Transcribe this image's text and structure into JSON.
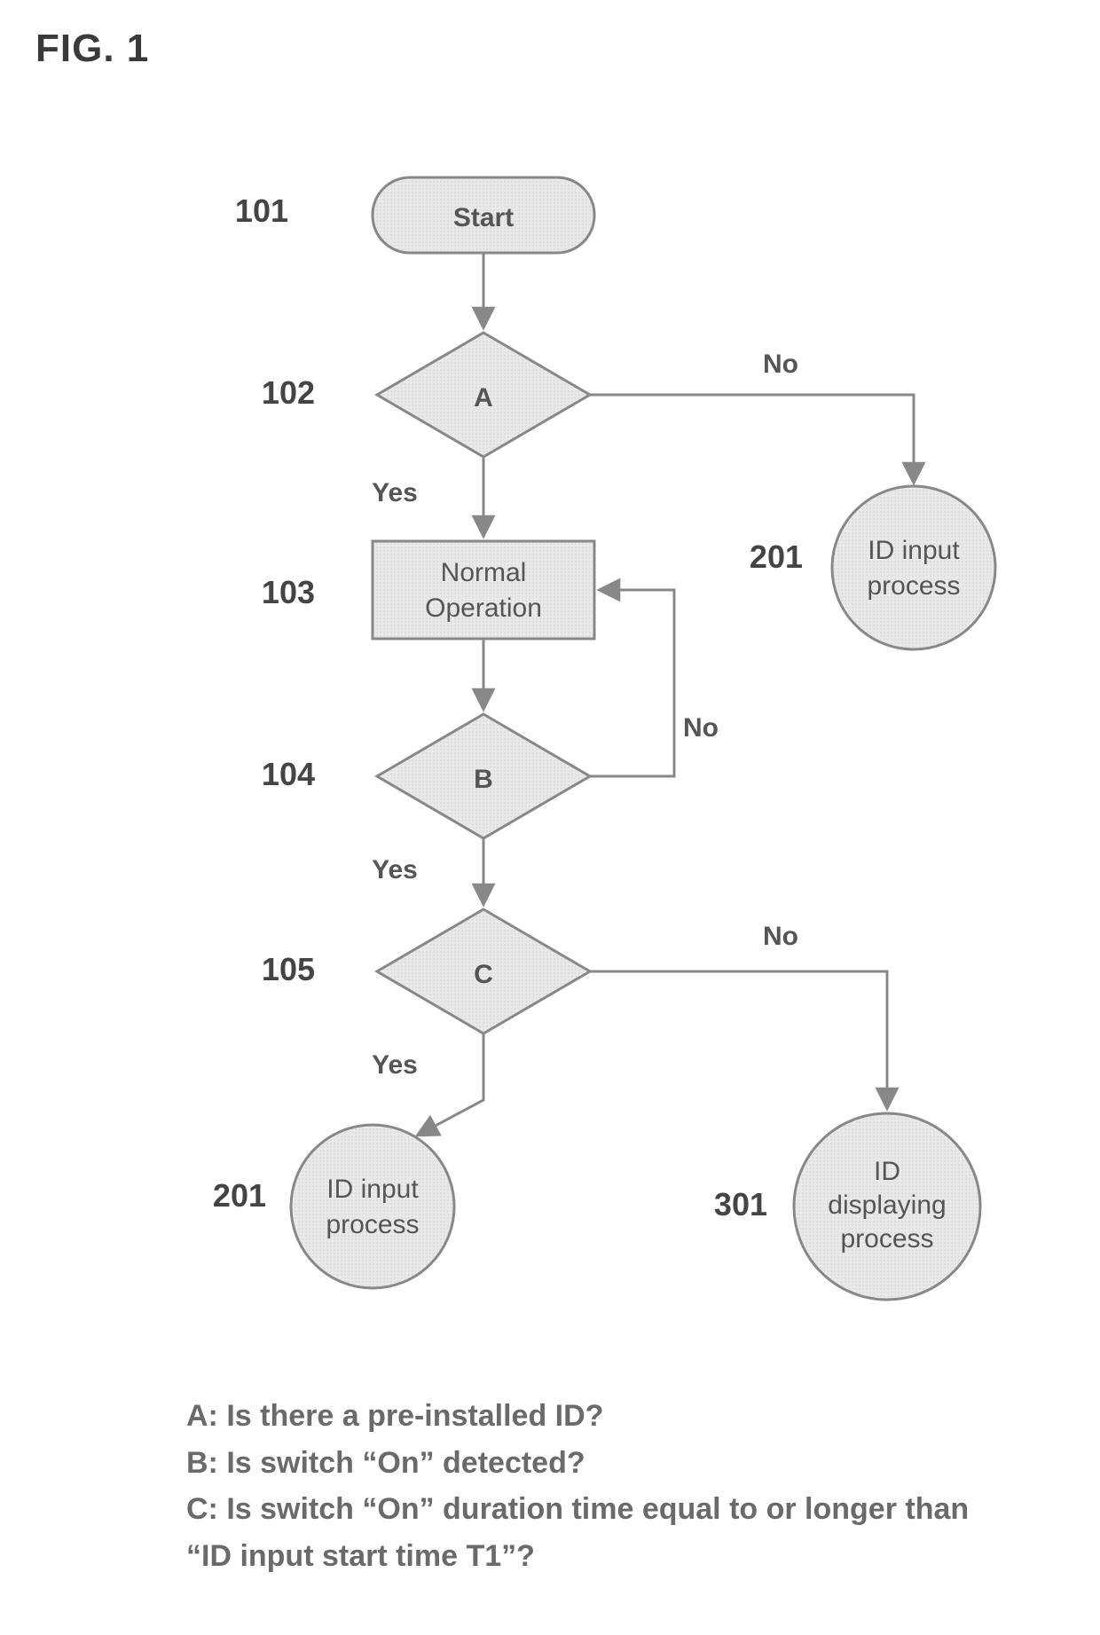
{
  "title": "FIG. 1",
  "nodes": {
    "start": {
      "ref": "101",
      "text": "Start"
    },
    "decA": {
      "ref": "102",
      "text": "A",
      "yes": "Yes",
      "no": "No"
    },
    "normal": {
      "ref": "103",
      "text1": "Normal",
      "text2": "Operation"
    },
    "decB": {
      "ref": "104",
      "text": "B",
      "yes": "Yes",
      "no": "No"
    },
    "decC": {
      "ref": "105",
      "text": "C",
      "yes": "Yes",
      "no": "No"
    },
    "input1": {
      "ref": "201",
      "text1": "ID input",
      "text2": "process"
    },
    "input2": {
      "ref": "201",
      "text1": "ID input",
      "text2": "process"
    },
    "display": {
      "ref": "301",
      "text1": "ID",
      "text2": "displaying",
      "text3": "process"
    }
  },
  "legend": {
    "a": "A: Is there a pre-installed ID?",
    "b": "B: Is switch “On” detected?",
    "c": "C: Is switch “On” duration time equal to or longer than  “ID input start time T1”?"
  },
  "colors": {
    "fill": "#e8e8e8",
    "stroke": "#888"
  }
}
